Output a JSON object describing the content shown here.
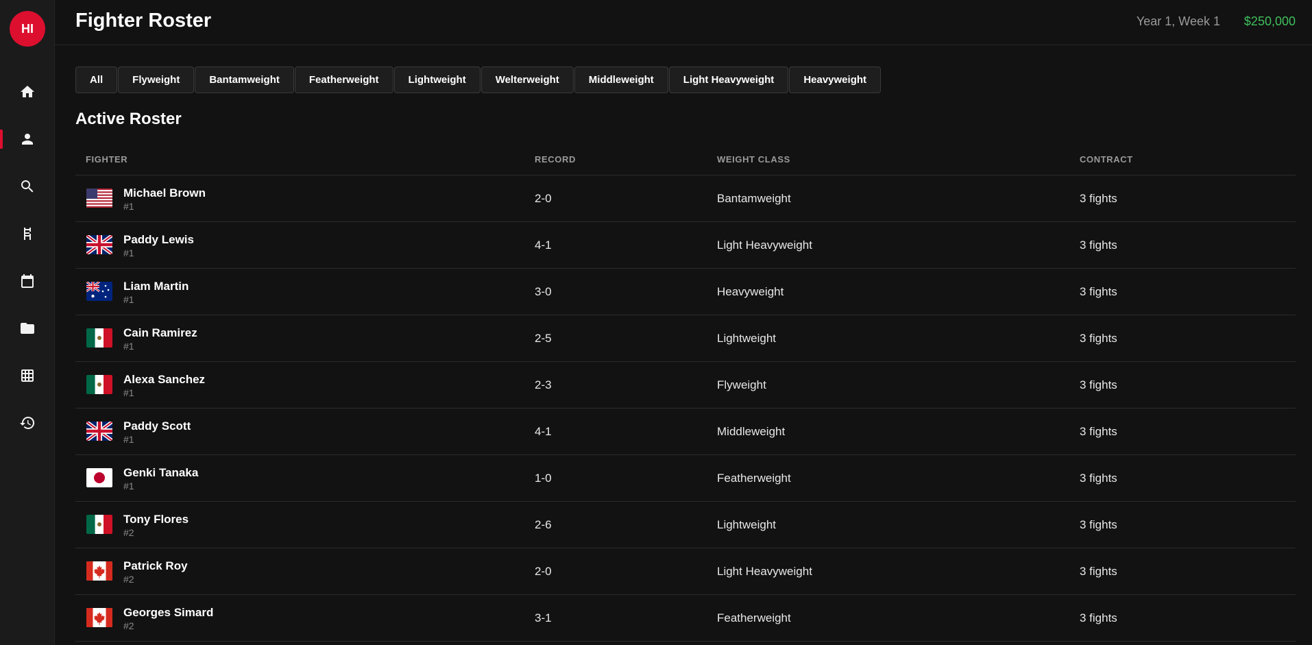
{
  "app": {
    "avatar_initials": "HI",
    "title": "Fighter Roster",
    "date": "Year 1, Week 1",
    "money": "$250,000",
    "accent": "#dc0f2f",
    "money_color": "#3fbf5c"
  },
  "sidebar": {
    "items": [
      {
        "icon": "home-icon",
        "active": false
      },
      {
        "icon": "person-icon",
        "active": true
      },
      {
        "icon": "search-icon",
        "active": false
      },
      {
        "icon": "boxing-ring-icon",
        "active": false
      },
      {
        "icon": "calendar-icon",
        "active": false
      },
      {
        "icon": "folder-icon",
        "active": false
      },
      {
        "icon": "grid-icon",
        "active": false
      },
      {
        "icon": "history-icon",
        "active": false
      }
    ]
  },
  "filters": [
    "All",
    "Flyweight",
    "Bantamweight",
    "Featherweight",
    "Lightweight",
    "Welterweight",
    "Middleweight",
    "Light Heavyweight",
    "Heavyweight"
  ],
  "roster": {
    "title": "Active Roster",
    "columns": [
      "FIGHTER",
      "RECORD",
      "WEIGHT CLASS",
      "CONTRACT"
    ],
    "rows": [
      {
        "flag": "us-flag-icon",
        "name": "Michael Brown",
        "rank": "#1",
        "record": "2-0",
        "weight_class": "Bantamweight",
        "contract": "3 fights"
      },
      {
        "flag": "uk-flag-icon",
        "name": "Paddy Lewis",
        "rank": "#1",
        "record": "4-1",
        "weight_class": "Light Heavyweight",
        "contract": "3 fights"
      },
      {
        "flag": "au-flag-icon",
        "name": "Liam Martin",
        "rank": "#1",
        "record": "3-0",
        "weight_class": "Heavyweight",
        "contract": "3 fights"
      },
      {
        "flag": "mx-flag-icon",
        "name": "Cain Ramirez",
        "rank": "#1",
        "record": "2-5",
        "weight_class": "Lightweight",
        "contract": "3 fights"
      },
      {
        "flag": "mx-flag-icon",
        "name": "Alexa Sanchez",
        "rank": "#1",
        "record": "2-3",
        "weight_class": "Flyweight",
        "contract": "3 fights"
      },
      {
        "flag": "uk-flag-icon",
        "name": "Paddy Scott",
        "rank": "#1",
        "record": "4-1",
        "weight_class": "Middleweight",
        "contract": "3 fights"
      },
      {
        "flag": "jp-flag-icon",
        "name": "Genki Tanaka",
        "rank": "#1",
        "record": "1-0",
        "weight_class": "Featherweight",
        "contract": "3 fights"
      },
      {
        "flag": "mx-flag-icon",
        "name": "Tony Flores",
        "rank": "#2",
        "record": "2-6",
        "weight_class": "Lightweight",
        "contract": "3 fights"
      },
      {
        "flag": "ca-flag-icon",
        "name": "Patrick Roy",
        "rank": "#2",
        "record": "2-0",
        "weight_class": "Light Heavyweight",
        "contract": "3 fights"
      },
      {
        "flag": "ca-flag-icon",
        "name": "Georges Simard",
        "rank": "#2",
        "record": "3-1",
        "weight_class": "Featherweight",
        "contract": "3 fights"
      }
    ]
  }
}
